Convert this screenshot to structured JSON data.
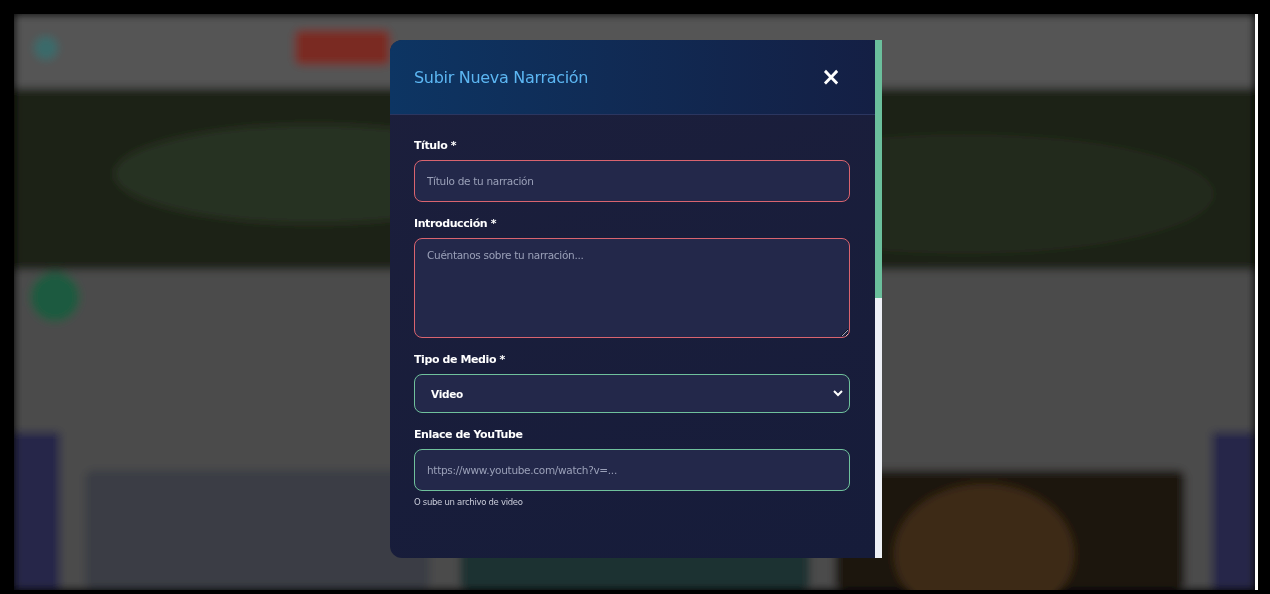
{
  "modal": {
    "title": "Subir Nueva Narración",
    "close": "×",
    "fields": [
      {
        "kind": "text",
        "label": "Título *",
        "placeholder": "Título de tu narración",
        "valid": false
      },
      {
        "kind": "textarea",
        "label": "Introducción *",
        "placeholder": "Cuéntanos sobre tu narración...",
        "valid": false
      },
      {
        "kind": "select",
        "label": "Tipo de Medio *",
        "value": "Video",
        "valid": true
      },
      {
        "kind": "text",
        "label": "Enlace de YouTube",
        "placeholder": "https://www.youtube.com/watch?v=...",
        "valid": true,
        "hint": "O sube un archivo de video"
      }
    ]
  }
}
